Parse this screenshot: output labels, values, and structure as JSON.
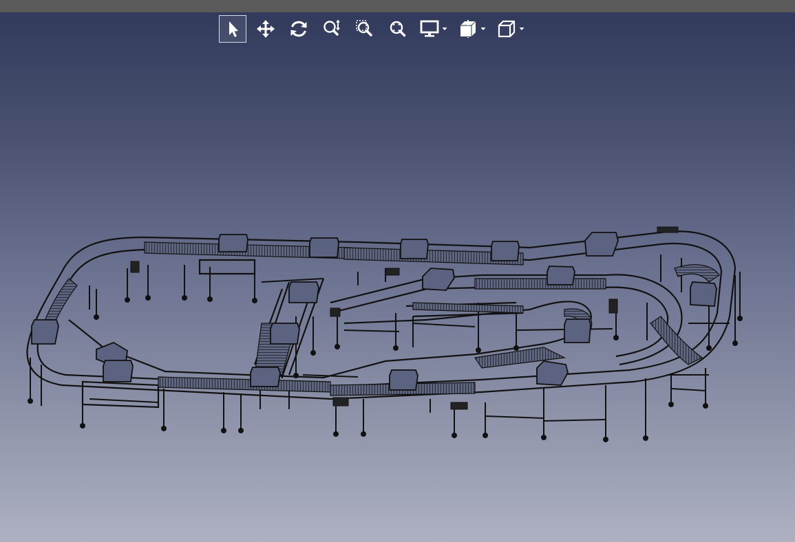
{
  "window": {
    "title_bar_color": "#5a5a5a"
  },
  "toolbar": {
    "tools": [
      {
        "icon": "select-pointer-icon",
        "active": true
      },
      {
        "icon": "pan-move-icon",
        "active": false
      },
      {
        "icon": "rotate-orbit-icon",
        "active": false
      },
      {
        "icon": "zoom-dynamic-icon",
        "active": false
      },
      {
        "icon": "zoom-window-icon",
        "active": false
      },
      {
        "icon": "zoom-fit-icon",
        "active": false
      },
      {
        "icon": "display-mode-icon",
        "active": false,
        "has_dropdown": true
      },
      {
        "icon": "section-view-icon",
        "active": false,
        "has_dropdown": true
      },
      {
        "icon": "view-cube-icon",
        "active": false,
        "has_dropdown": true
      }
    ]
  },
  "viewport": {
    "content": "3d-wireframe-conveyor-model",
    "background_top": "#30385a",
    "background_bottom": "#adb1c1",
    "line_color": "#111111"
  }
}
